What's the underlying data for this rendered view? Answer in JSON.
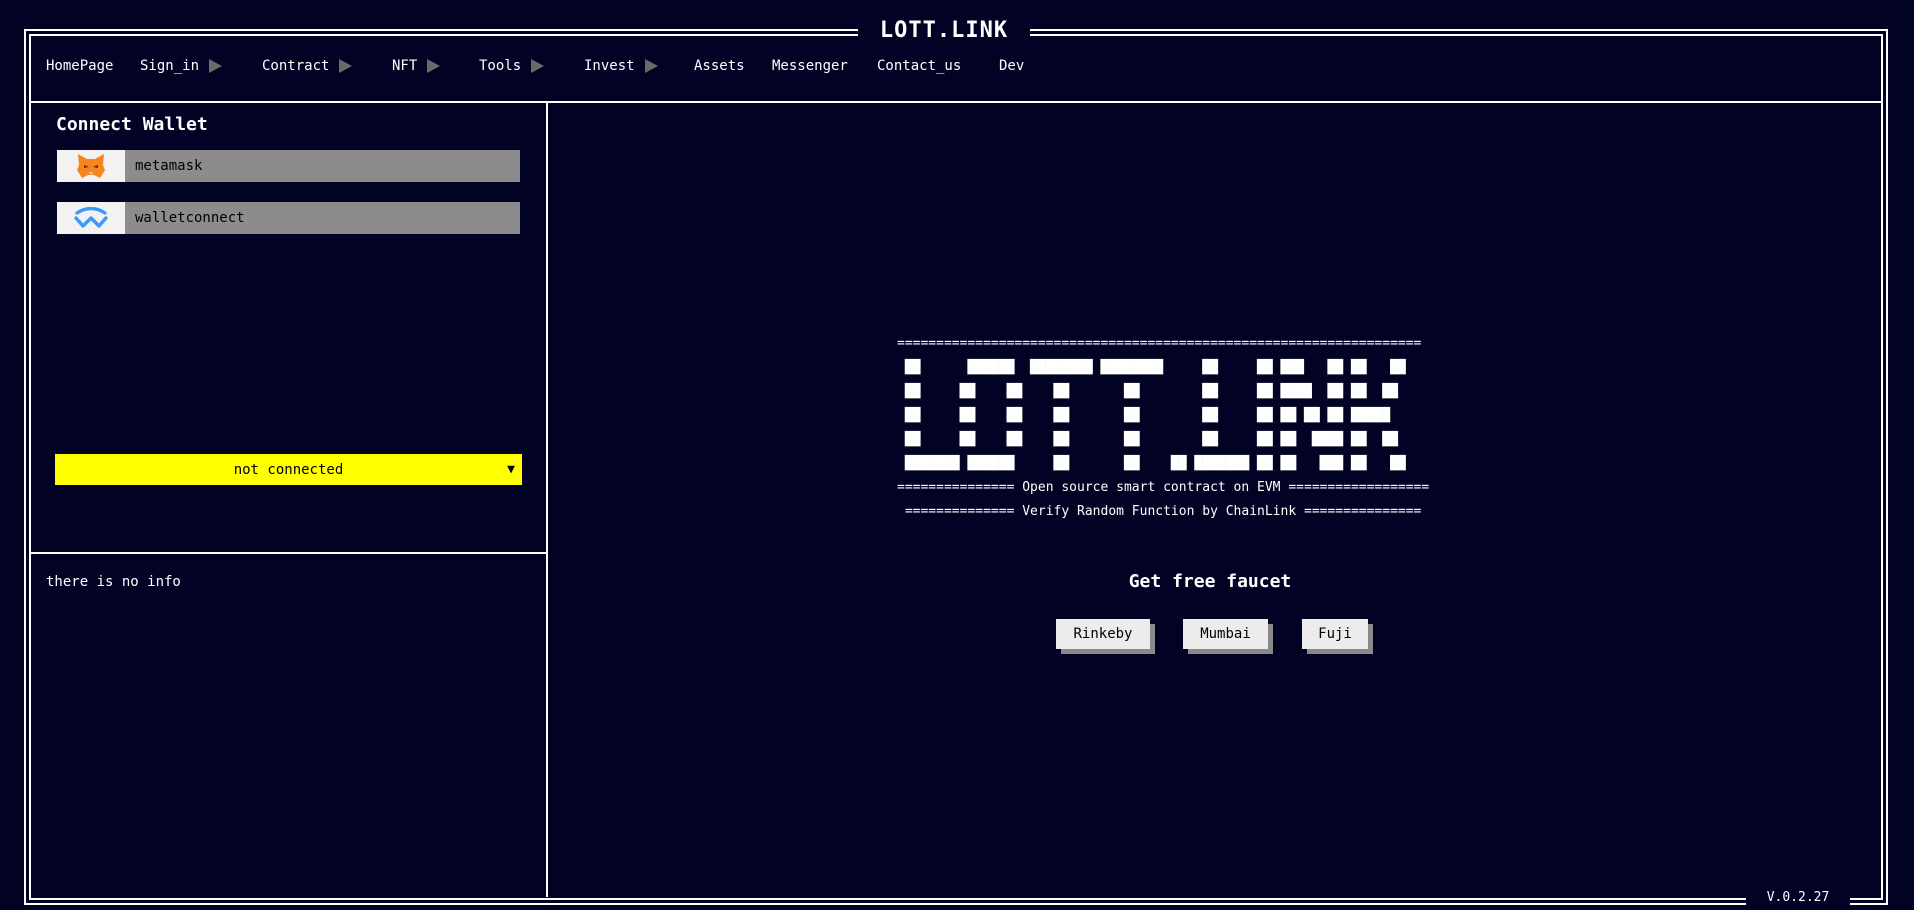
{
  "app": {
    "title": "LOTT.LINK",
    "version": "V.0.2.27"
  },
  "nav": {
    "items": [
      {
        "label": "HomePage",
        "submenu": false
      },
      {
        "label": "Sign_in",
        "submenu": true
      },
      {
        "label": "Contract",
        "submenu": true
      },
      {
        "label": "NFT",
        "submenu": true
      },
      {
        "label": "Tools",
        "submenu": true
      },
      {
        "label": "Invest",
        "submenu": true
      },
      {
        "label": "Assets",
        "submenu": false
      },
      {
        "label": "Messenger",
        "submenu": false
      },
      {
        "label": "Contact_us",
        "submenu": false
      },
      {
        "label": "Dev",
        "submenu": false
      }
    ]
  },
  "sidebar": {
    "connect_title": "Connect Wallet",
    "wallets": [
      {
        "name": "metamask",
        "icon": "metamask-fox-icon",
        "color": "#f6851b"
      },
      {
        "name": "walletconnect",
        "icon": "walletconnect-icon",
        "color": "#3b99fc"
      }
    ],
    "status": {
      "label": "not connected",
      "caret": "▼",
      "color": "#ffff00"
    },
    "info": "there is no info"
  },
  "main": {
    "banner": {
      "border_top": "===================================================================",
      "art": [
        " ██      ██████  ████████ ████████     ██     ██ ███   ██ ██   ██",
        " ██     ██    ██    ██       ██        ██     ██ ████  ██ ██  ██",
        " ██     ██    ██    ██       ██        ██     ██ ██ ██ ██ █████",
        " ██     ██    ██    ██       ██        ██     ██ ██  ████ ██  ██",
        " ███████ ██████     ██       ██    ██ ███████ ██ ██   ███ ██   ██"
      ],
      "tagline_1": "=============== Open source smart contract on EVM ==================",
      "tagline_2": " ============== Verify Random Function by ChainLink ==============="
    },
    "faucet": {
      "title": "Get free faucet",
      "buttons": [
        "Rinkeby",
        "Mumbai",
        "Fuji"
      ]
    }
  }
}
